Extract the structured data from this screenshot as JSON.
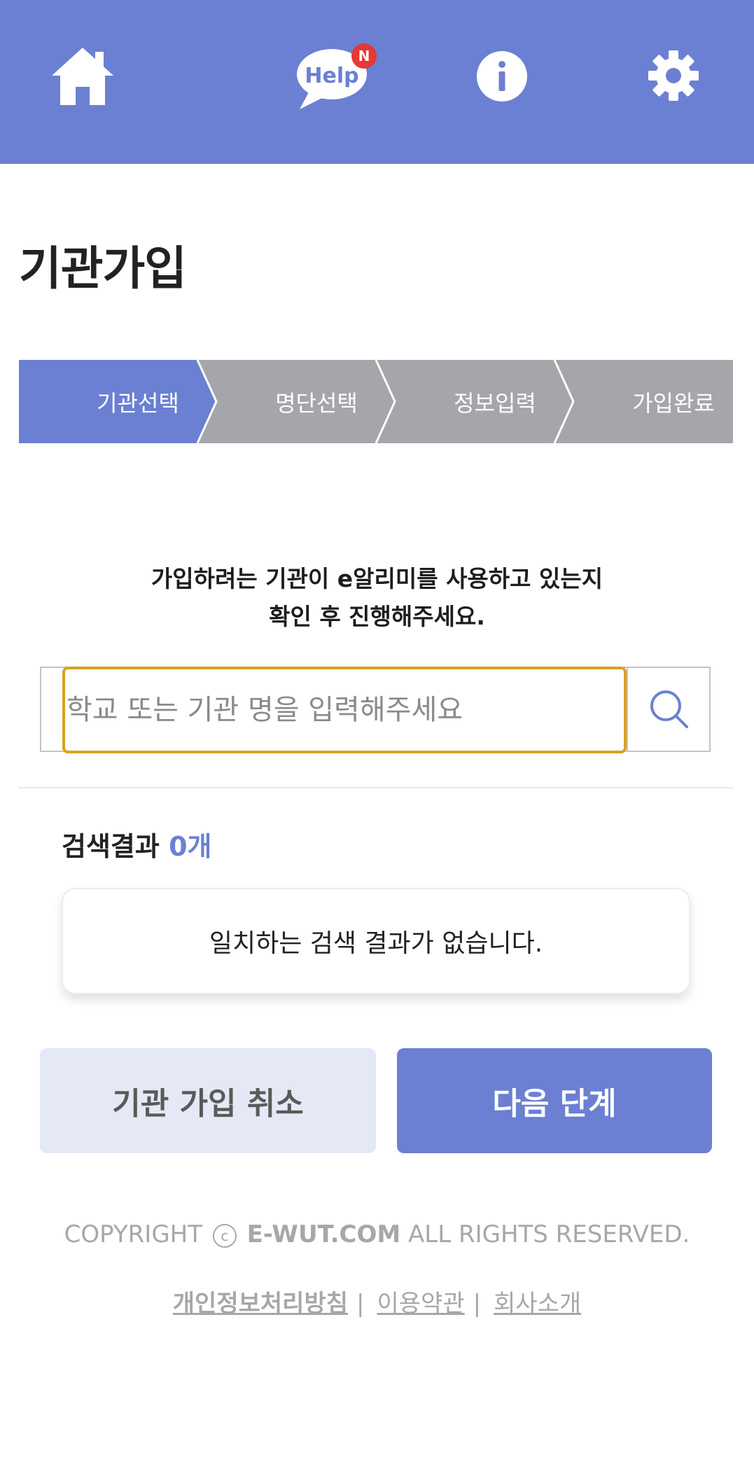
{
  "header": {
    "help_label": "Help",
    "help_badge": "N",
    "icons": [
      "home-icon",
      "help-bubble-icon",
      "info-icon",
      "gear-icon"
    ],
    "color": "#6b80d2"
  },
  "page_title": "기관가입",
  "steps": [
    {
      "label": "기관선택",
      "active": true
    },
    {
      "label": "명단선택",
      "active": false
    },
    {
      "label": "정보입력",
      "active": false
    },
    {
      "label": "가입완료",
      "active": false
    }
  ],
  "notice": {
    "line1": "가입하려는 기관이 e알리미를 사용하고 있는지",
    "line2": "확인 후 진행해주세요."
  },
  "search": {
    "value": "",
    "placeholder": "학교 또는 기관 명을 입력해주세요"
  },
  "results": {
    "label": "검색결과",
    "count": "0개",
    "empty_message": "일치하는 검색 결과가 없습니다."
  },
  "buttons": {
    "cancel": "기관 가입 취소",
    "next": "다음 단계"
  },
  "footer": {
    "copyright_prefix": "COPYRIGHT",
    "copyright_symbol": "c",
    "domain": "E-WUT.COM",
    "rights": "ALL RIGHTS RESERVED.",
    "links": [
      "개인정보처리방침",
      "이용약관",
      "회사소개"
    ],
    "separator": "|"
  },
  "colors": {
    "accent": "#6b80d2",
    "step_inactive": "#a5a6aa",
    "focus_border": "#d9a21f",
    "badge": "#e53935"
  }
}
